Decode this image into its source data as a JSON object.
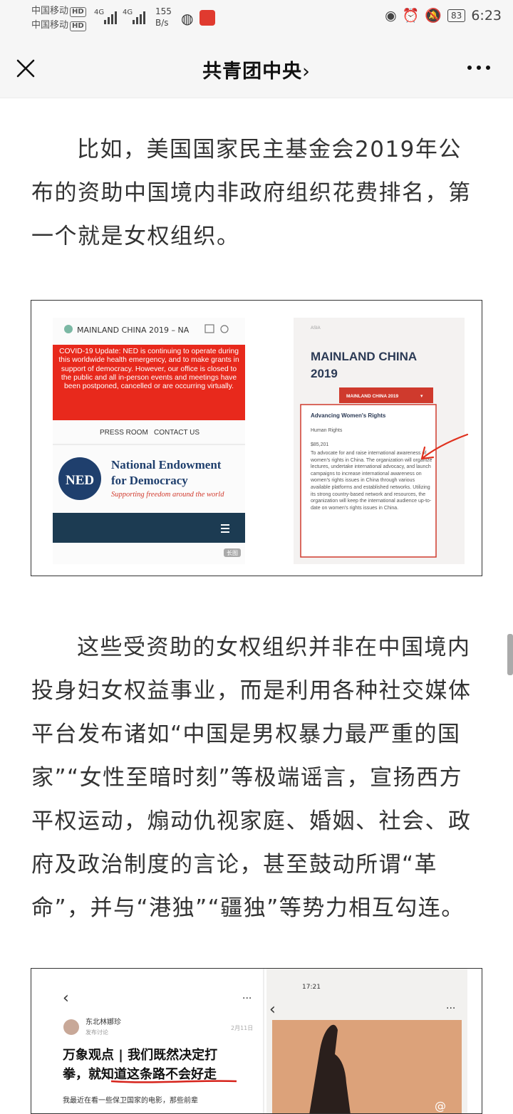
{
  "status_bar": {
    "carrier1": "中国移动",
    "carrier2": "中国移动",
    "hd": "HD",
    "net1": "4G",
    "net2": "4G",
    "speed_value": "155",
    "speed_unit": "B/s",
    "battery": "83",
    "time": "6:23"
  },
  "nav": {
    "title": "共青团中央",
    "chevron": "›"
  },
  "article": {
    "para1": "比如，美国国家民主基金会2019年公布的资助中国境内非政府组织花费排名，第一个就是女权组织。",
    "para2": "这些受资助的女权组织并非在中国境内投身妇女权益事业，而是利用各种社交媒体平台发布诸如“中国是男权暴力最严重的国家”“女性至暗时刻”等极端谣言，宣扬西方平权运动，煽动仇视家庭、婚姻、社会、政府及政治制度的言论，甚至鼓动所谓“革命”，并与“港独”“疆独”等势力相互勾连。"
  },
  "figure1": {
    "tab_title": "MAINLAND CHINA 2019 – NA",
    "covid_text": "COVID-19 Update: NED is continuing to operate during this worldwide health emergency, and to make grants in support of democracy. However, our office is closed to the public and all in-person events and meetings have been postponed, cancelled or are occurring virtually.",
    "links": [
      "PRESS ROOM",
      "CONTACT US"
    ],
    "logo_text": "NED",
    "org_name_1": "National Endowment",
    "org_name_2": "for Democracy",
    "tagline": "Supporting freedom around the world",
    "long_image_tag": "长图",
    "region_tag": "ASIA",
    "heading_1": "MAINLAND CHINA",
    "heading_2": "2019",
    "dropdown": "MAINLAND CHINA 2019",
    "card_title": "Advancing Women's Rights",
    "card_category": "Human Rights",
    "card_amount": "$85,201",
    "card_desc": "To advocate for and raise international awareness of women's rights in China. The organization will organize lectures, undertake international advocacy, and launch campaigns to increase international awareness on women's rights issues in China through various available platforms and established networks. Utilizing its strong country-based network and resources, the organization will keep the international audience up-to-date on women's rights issues in China."
  },
  "figure2": {
    "author": "东北林娜珍",
    "sub": "发布讨论",
    "date": "2月11日",
    "headline_1": "万象观点 | 我们既然决定打",
    "headline_2": "拳，就知道这条路不会好走",
    "body": "我最近在看一些保卫国家的电影，那些前辈",
    "phone_time": "17:21",
    "watermark": "@"
  },
  "colors": {
    "ned_red": "#e8291c",
    "ned_blue": "#1f3f6d",
    "nav_bg": "#f6f6f6"
  }
}
